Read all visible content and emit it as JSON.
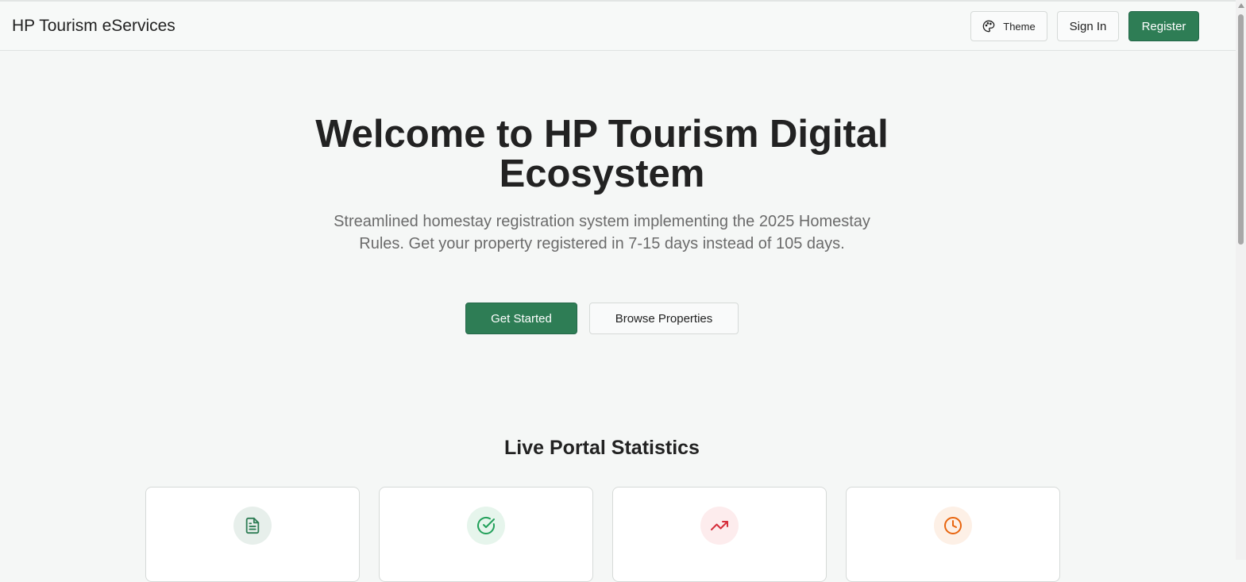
{
  "header": {
    "brand": "HP Tourism eServices",
    "theme_label": "Theme",
    "signin_label": "Sign In",
    "register_label": "Register"
  },
  "hero": {
    "title_line1": "Welcome to HP Tourism Digital",
    "title_line2": "Ecosystem",
    "subtitle": "Streamlined homestay registration system implementing the 2025 Homestay Rules. Get your property registered in 7-15 days instead of 105 days.",
    "get_started_label": "Get Started",
    "browse_label": "Browse Properties"
  },
  "stats": {
    "title": "Live Portal Statistics",
    "cards": [
      {
        "icon": "document-icon",
        "icon_color": "#2e7d55",
        "icon_bg": "#e7efeb",
        "label": ""
      },
      {
        "icon": "check-circle-icon",
        "icon_color": "#22a05a",
        "icon_bg": "#e6f5ec",
        "label": ""
      },
      {
        "icon": "trending-up-icon",
        "icon_color": "#d62e3b",
        "icon_bg": "#fdeced",
        "label": ""
      },
      {
        "icon": "clock-icon",
        "icon_color": "#e8650f",
        "icon_bg": "#fdf0e6",
        "label": ""
      }
    ]
  },
  "colors": {
    "primary": "#2e7d55",
    "background": "#f5f7f6"
  }
}
